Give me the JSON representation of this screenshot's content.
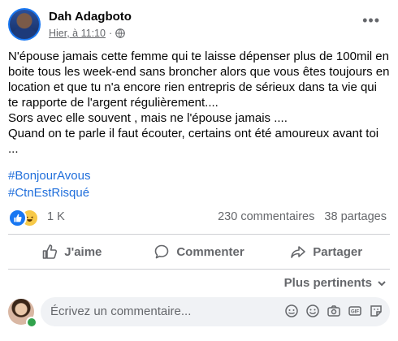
{
  "post": {
    "author": "Dah Adagboto",
    "time": "Hier, à 11:10",
    "separator": "·",
    "more_icon": "more-horizontal-icon",
    "privacy_icon": "globe-icon",
    "text_lines": [
      "N'épouse jamais cette femme qui te laisse dépenser plus de 100mil en boite tous les week-end sans broncher alors que vous êtes toujours en location et que tu n'a encore rien entrepris de sérieux dans ta vie qui te rapporte de l'argent régulièrement....",
      "Sors avec elle souvent , mais ne l'épouse jamais ....",
      "Quand on te parle il faut écouter,  certains ont été amoureux avant toi ..."
    ],
    "hashtags": [
      "#BonjourAvous",
      "#CtnEstRisqué"
    ]
  },
  "reactions": {
    "types": [
      "like",
      "haha"
    ],
    "count": "1 K",
    "comments": "230 commentaires",
    "shares": "38 partages"
  },
  "actions": {
    "like": "J'aime",
    "comment": "Commenter",
    "share": "Partager"
  },
  "comments": {
    "sort_label": "Plus pertinents",
    "placeholder": "Écrivez un commentaire...",
    "tools": [
      "sticker-icon",
      "emoji-icon",
      "camera-icon",
      "gif-icon",
      "sticker-face-icon"
    ]
  },
  "colors": {
    "link": "#216fdb",
    "secondary_text": "#65676b",
    "like_blue": "#1877f2"
  }
}
